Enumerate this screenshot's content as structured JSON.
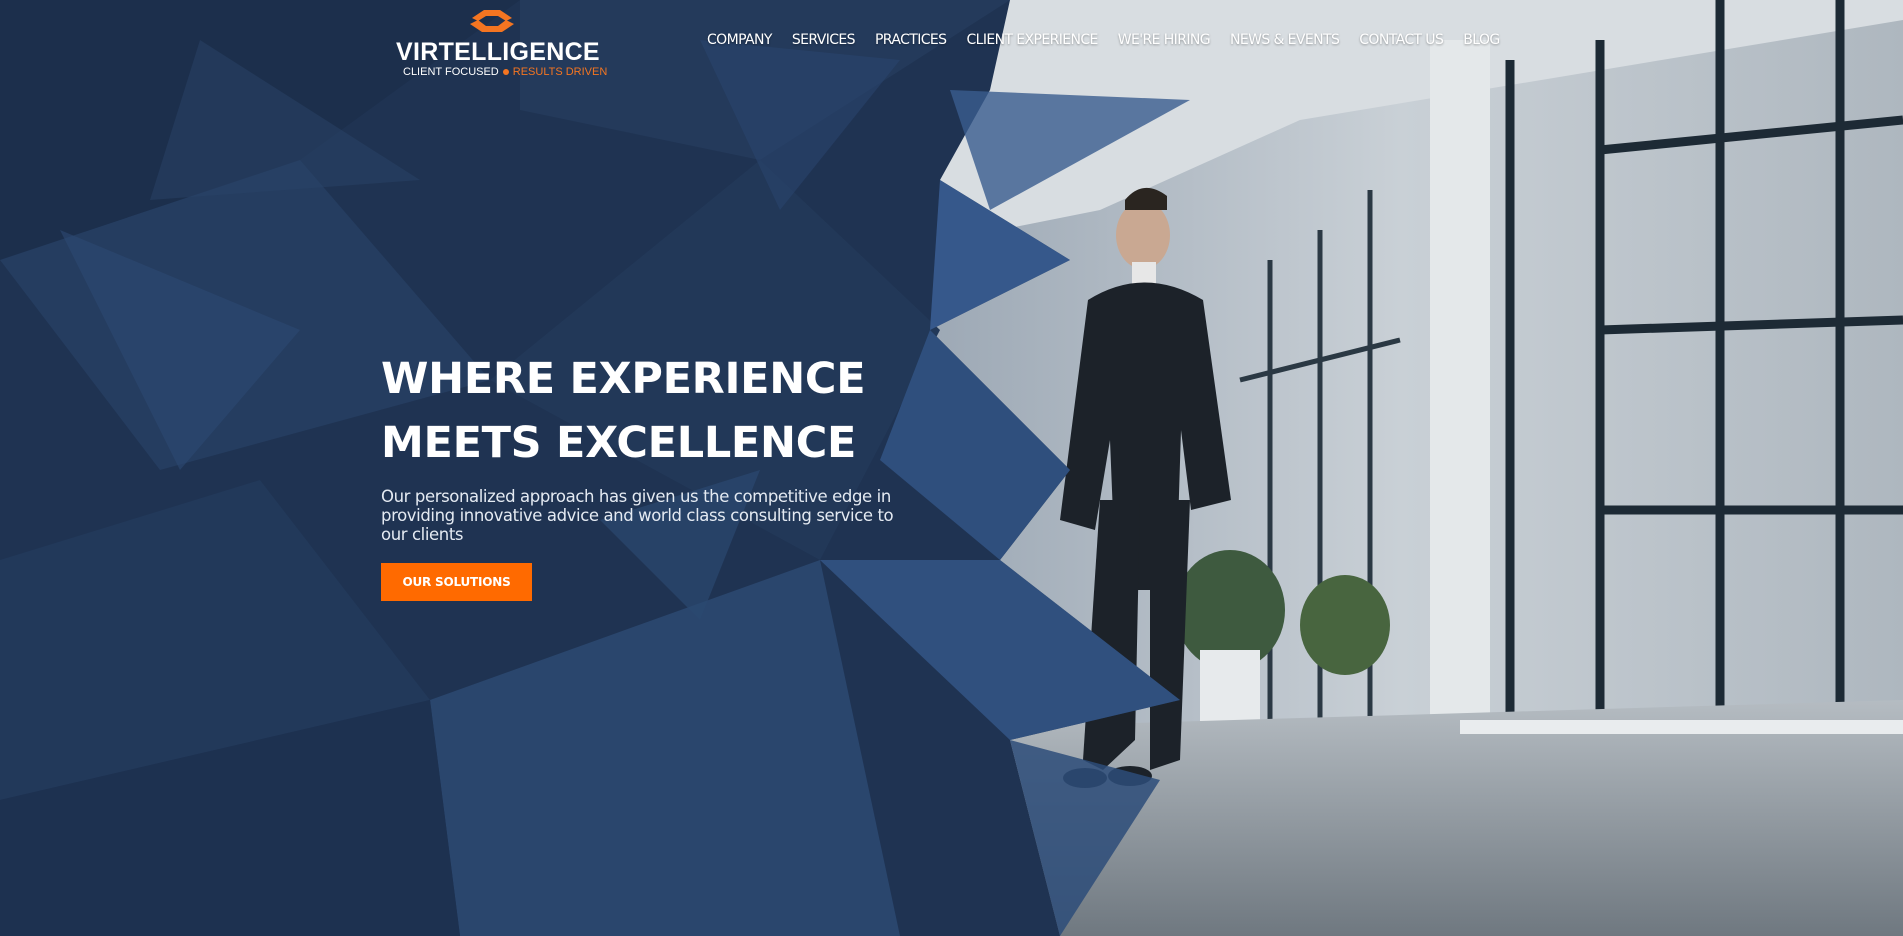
{
  "brand": {
    "name": "VIRTELLIGENCE",
    "tagline_left": "CLIENT FOCUSED",
    "tagline_right": "RESULTS DRIVEN",
    "accent_color": "#f47521"
  },
  "nav": {
    "items": [
      {
        "label": "COMPANY"
      },
      {
        "label": "SERVICES"
      },
      {
        "label": "PRACTICES"
      },
      {
        "label": "CLIENT EXPERIENCE"
      },
      {
        "label": "WE'RE HIRING"
      },
      {
        "label": "NEWS & EVENTS"
      },
      {
        "label": "CONTACT US"
      },
      {
        "label": "BLOG"
      }
    ]
  },
  "hero": {
    "title_line1": "WHERE EXPERIENCE",
    "title_line2": "MEETS EXCELLENCE",
    "subtitle": "Our personalized approach has given us the competitive edge in providing innovative advice and world class consulting service to our clients",
    "cta_label": "OUR SOLUTIONS",
    "cta_color": "#ff6a00",
    "overlay_color": "#1f3352"
  }
}
